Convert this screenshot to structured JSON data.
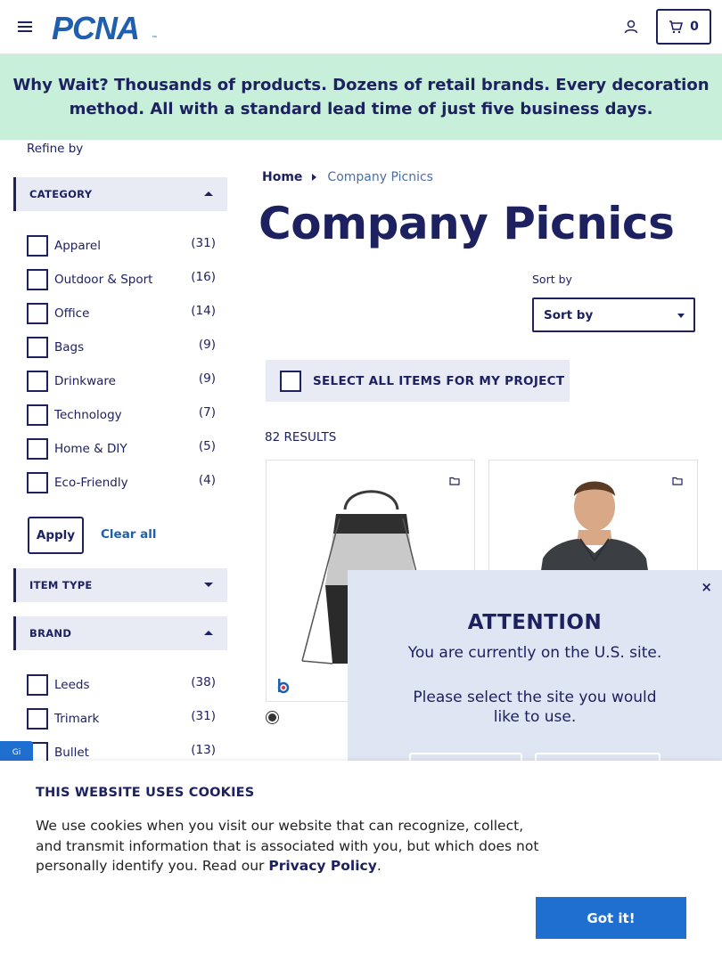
{
  "header": {
    "logo_text": "PCNA",
    "cart_count": "0"
  },
  "banner": {
    "lead": "Why Wait?",
    "text": "Thousands of products. Dozens of retail brands. Every decoration method. All with a standard lead time of just five business days."
  },
  "sidebar": {
    "refine_label": "Refine by",
    "category": {
      "title": "CATEGORY",
      "items": [
        {
          "label": "Apparel",
          "count": "(31)"
        },
        {
          "label": "Outdoor & Sport",
          "count": "(16)"
        },
        {
          "label": "Office",
          "count": "(14)"
        },
        {
          "label": "Bags",
          "count": "(9)"
        },
        {
          "label": "Drinkware",
          "count": "(9)"
        },
        {
          "label": "Technology",
          "count": "(7)"
        },
        {
          "label": "Home & DIY",
          "count": "(5)"
        },
        {
          "label": "Eco-Friendly",
          "count": "(4)"
        }
      ],
      "apply_label": "Apply",
      "clear_label": "Clear all"
    },
    "item_type": {
      "title": "ITEM TYPE"
    },
    "brand": {
      "title": "BRAND",
      "items": [
        {
          "label": "Leeds",
          "count": "(38)"
        },
        {
          "label": "Trimark",
          "count": "(31)"
        },
        {
          "label": "Bullet",
          "count": "(13)"
        }
      ]
    }
  },
  "breadcrumb": {
    "home": "Home",
    "current": "Company Picnics"
  },
  "page_title": "Company Picnics",
  "sort": {
    "label": "Sort by",
    "selected": "Sort by"
  },
  "select_all_label": "SELECT ALL ITEMS FOR MY PROJECT",
  "results_label": "82 RESULTS",
  "feedback_tab": "Gi",
  "attention": {
    "title": "ATTENTION",
    "line1": "You are currently on the U.S. site.",
    "line2": "Please select the site you would like to use.",
    "close": "×"
  },
  "cookie": {
    "heading": "THIS WEBSITE USES COOKIES",
    "body": "We use cookies when you visit our website that can recognize, collect, and transmit information that is associated with you, but which does not personally identify you. Read our ",
    "link": "Privacy Policy",
    "end": ".",
    "button": "Got it!"
  },
  "colors": {
    "navy": "#1d2160",
    "banner_bg": "#c7efd9",
    "accent_blue": "#1f6fd1",
    "facet_bg": "#e8ebf3",
    "popup_bg": "#dfe6f3"
  }
}
